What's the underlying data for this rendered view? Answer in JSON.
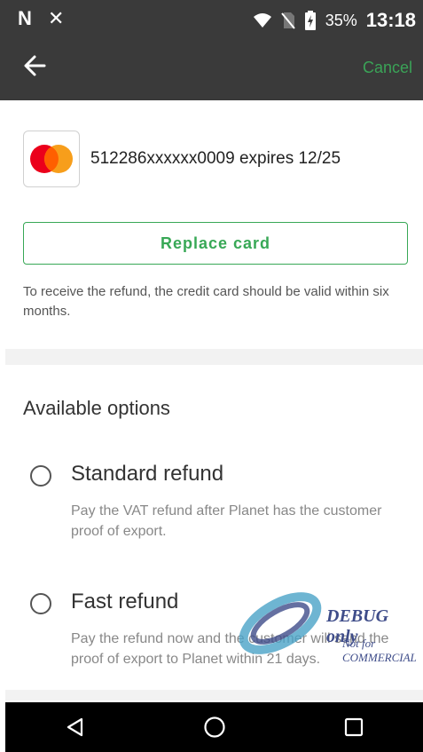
{
  "status_bar": {
    "left_icons": "N ✕",
    "battery": "35%",
    "time": "13:18"
  },
  "app_bar": {
    "back_icon": "arrow-left-icon",
    "cancel_label": "Cancel"
  },
  "card": {
    "brand_icon": "mastercard-logo",
    "text": "512286xxxxxx0009 expires 12/25"
  },
  "replace_button": "Replace card",
  "refund_note": "To receive the refund, the credit card should be valid within six months.",
  "options_section": {
    "title": "Available options",
    "options": [
      {
        "title": "Standard refund",
        "description": "Pay the VAT refund after Planet has the customer proof of export."
      },
      {
        "title": "Fast refund",
        "description": "Pay the refund now and the customer will send the proof of export to Planet within 21 days."
      }
    ]
  },
  "watermark": {
    "line1": "DEBUG only",
    "line2": "Not for COMMERCIAL"
  },
  "nav_bar": {
    "back_icon": "triangle-back-icon",
    "home_icon": "circle-home-icon",
    "recents_icon": "square-recents-icon"
  },
  "colors": {
    "accent": "#38a856",
    "app_bar": "#3a3a3a",
    "mastercard_red": "#eb001b",
    "mastercard_orange": "#f79e1b"
  }
}
